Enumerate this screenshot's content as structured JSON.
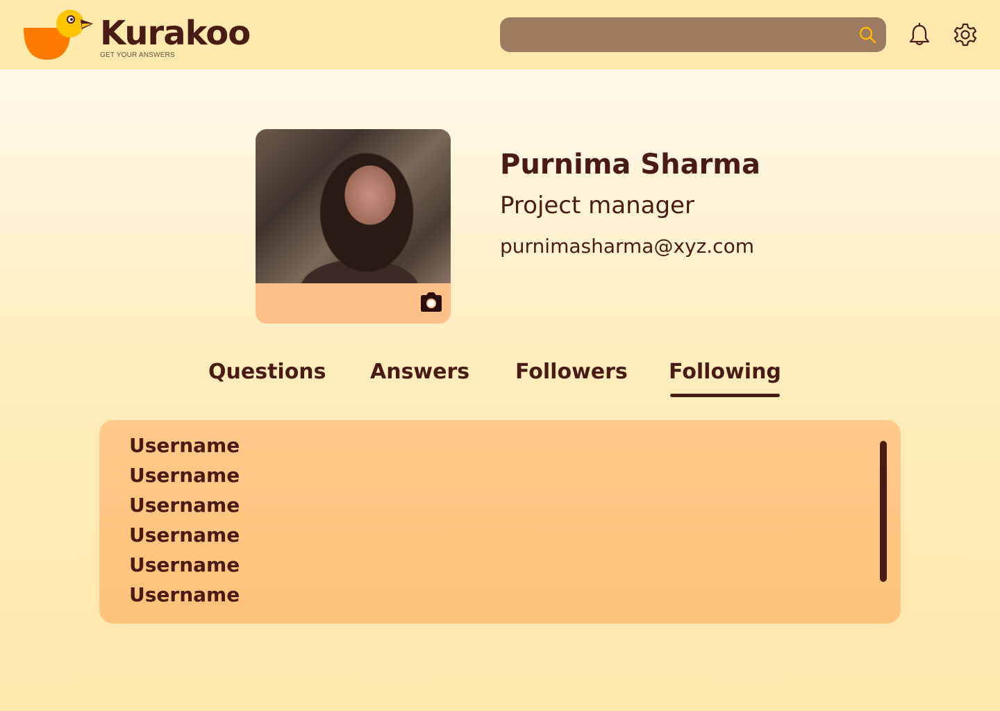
{
  "header": {
    "brand": "Kurakoo",
    "tagline": "GET YOUR ANSWERS",
    "search_placeholder": "",
    "icons": [
      "search-icon",
      "bell-icon",
      "gear-icon"
    ]
  },
  "profile": {
    "name": "Purnima Sharma",
    "role": "Project manager",
    "email": "purnimasharma@xyz.com",
    "photo_action_icon": "camera-icon"
  },
  "tabs": [
    {
      "label": "Questions",
      "active": false
    },
    {
      "label": "Answers",
      "active": false
    },
    {
      "label": "Followers",
      "active": false
    },
    {
      "label": "Following",
      "active": true
    }
  ],
  "following_list": [
    "Username",
    "Username",
    "Username",
    "Username",
    "Username",
    "Username"
  ],
  "colors": {
    "brand_dark": "#4a1a14",
    "header_bg": "#ffe9ad",
    "search_bg": "#9c7b61",
    "panel_bg": "#ffc27a",
    "accent_orange": "#ff7a00",
    "accent_yellow": "#ffc400"
  }
}
